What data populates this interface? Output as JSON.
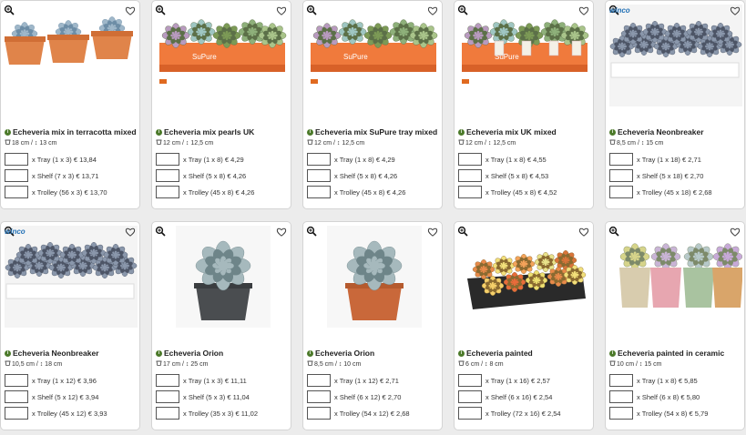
{
  "products": [
    {
      "name": "Echeveria mix in terracotta mixed",
      "dims": "18 cm / ↕ 13 cm",
      "winco": "",
      "opts": [
        "x Tray (1 x 3) € 13,84",
        "x Shelf (7 x 3) € 13,71",
        "x Trolley (56 x 3) € 13,70"
      ],
      "img": "terracotta"
    },
    {
      "name": "Echeveria mix pearls UK",
      "dims": "12 cm / ↕ 12,5 cm",
      "winco": "",
      "opts": [
        "x Tray (1 x 8) € 4,29",
        "x Shelf (5 x 8) € 4,26",
        "x Trolley (45 x 8) € 4,26"
      ],
      "img": "tray-orange"
    },
    {
      "name": "Echeveria mix SuPure tray mixed",
      "dims": "12 cm / ↕ 12,5 cm",
      "winco": "",
      "opts": [
        "x Tray (1 x 8) € 4,29",
        "x Shelf (5 x 8) € 4,26",
        "x Trolley (45 x 8) € 4,26"
      ],
      "img": "tray-orange"
    },
    {
      "name": "Echeveria mix UK mixed",
      "dims": "12 cm / ↕ 12,5 cm",
      "winco": "",
      "opts": [
        "x Tray (1 x 8) € 4,55",
        "x Shelf (5 x 8) € 4,53",
        "x Trolley (45 x 8) € 4,52"
      ],
      "img": "tray-orange-tags"
    },
    {
      "name": "Echeveria Neonbreaker",
      "dims": "8,5 cm / ↕ 15 cm",
      "winco": "winco",
      "opts": [
        "x Tray (1 x 18) € 2,71",
        "x Shelf (5 x 18) € 2,70",
        "x Trolley (45 x 18) € 2,68"
      ],
      "img": "tray-white"
    },
    {
      "name": "Echeveria Neonbreaker",
      "dims": "10,5 cm / ↕ 18 cm",
      "winco": "winco",
      "opts": [
        "x Tray (1 x 12) € 3,96",
        "x Shelf (5 x 12) € 3,94",
        "x Trolley (45 x 12) € 3,93"
      ],
      "img": "tray-white"
    },
    {
      "name": "Echeveria Orion",
      "dims": "17 cm / ↕ 25 cm",
      "winco": "",
      "opts": [
        "x Tray (1 x 3) € 11,11",
        "x Shelf (5 x 3) € 11,04",
        "x Trolley (35 x 3) € 11,02"
      ],
      "img": "single-grey"
    },
    {
      "name": "Echeveria Orion",
      "dims": "8,5 cm / ↕ 10 cm",
      "winco": "",
      "opts": [
        "x Tray (1 x 12) € 2,71",
        "x Shelf (6 x 12) € 2,70",
        "x Trolley (54 x 12) € 2,68"
      ],
      "img": "single-terra"
    },
    {
      "name": "Echeveria painted",
      "dims": "6 cm / ↕ 8 cm",
      "winco": "",
      "opts": [
        "x Tray (1 x 16) € 2,57",
        "x Shelf (6 x 16) € 2,54",
        "x Trolley (72 x 16) € 2,54"
      ],
      "img": "painted-tray"
    },
    {
      "name": "Echeveria painted in ceramic",
      "dims": "10 cm / ↕ 15 cm",
      "winco": "",
      "opts": [
        "x Tray (1 x 8) € 5,85",
        "x Shelf (6 x 8) € 5,80",
        "x Trolley (54 x 8) € 5,79"
      ],
      "img": "ceramic"
    }
  ]
}
